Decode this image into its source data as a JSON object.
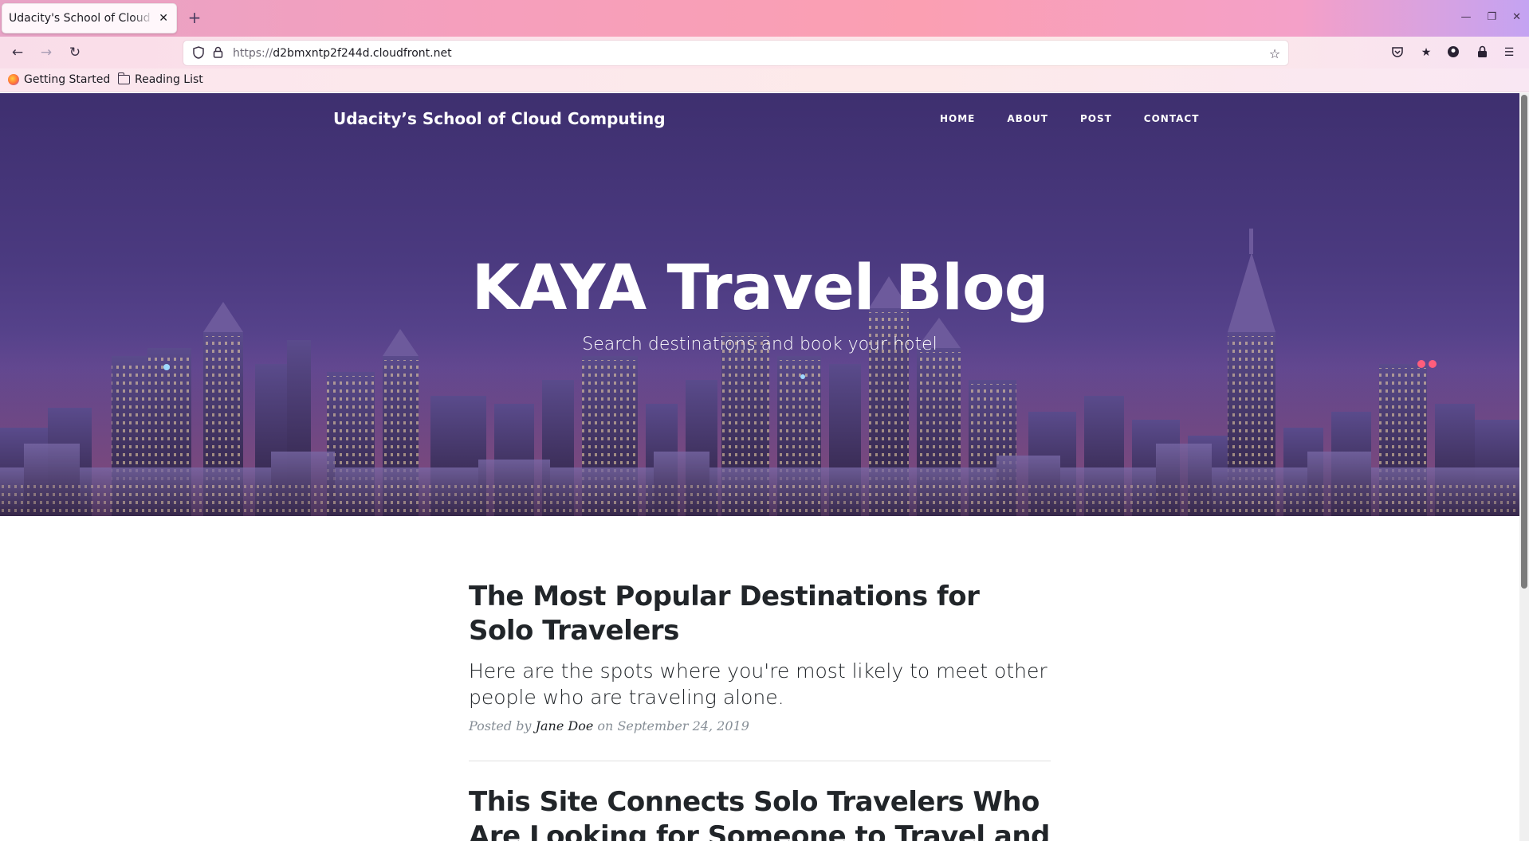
{
  "browser": {
    "tab_title": "Udacity's School of Cloud Computing",
    "tab_close": "✕",
    "new_tab": "+",
    "url_protocol": "https://",
    "url_host": "d2bmxntp2f244d.cloudfront.net",
    "bookmarks": [
      {
        "label": "Getting Started",
        "icon": "firefox-icon"
      },
      {
        "label": "Reading List",
        "icon": "folder-icon"
      }
    ],
    "window_controls": {
      "minimize": "—",
      "restore": "❐",
      "close": "✕"
    }
  },
  "site": {
    "brand": "Udacity’s School of Cloud Computing",
    "nav": [
      "HOME",
      "ABOUT",
      "POST",
      "CONTACT"
    ],
    "hero_title": "KAYA Travel Blog",
    "hero_subtitle": "Search destinations and book your hotel"
  },
  "posts": [
    {
      "title": "The Most Popular Destinations for Solo Travelers",
      "subtitle": "Here are the spots where you're most likely to meet other people who are traveling alone.",
      "posted_by_prefix": "Posted by",
      "author": "Jane Doe",
      "date_prefix": "on",
      "date": "September 24, 2019"
    },
    {
      "title": "This Site Connects Solo Travelers Who Are Looking for Someone to Travel and"
    }
  ],
  "colors": {
    "hero_top": "#3e2f6f",
    "hero_bottom": "#5c3f6e",
    "text_dark": "#212529",
    "meta_gray": "#868e96"
  }
}
